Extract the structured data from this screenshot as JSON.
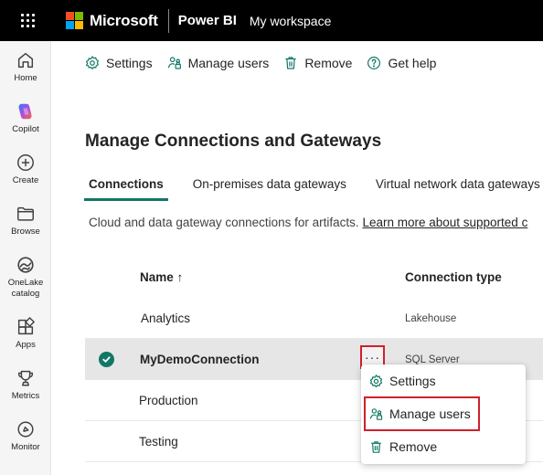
{
  "topbar": {
    "brand": "Microsoft",
    "app": "Power BI",
    "workspace": "My workspace",
    "logo_colors": [
      "#f25022",
      "#7fba00",
      "#00a4ef",
      "#ffb900"
    ]
  },
  "rail": {
    "items": [
      {
        "label": "Home",
        "icon": "home-icon"
      },
      {
        "label": "Copilot",
        "icon": "copilot-icon"
      },
      {
        "label": "Create",
        "icon": "create-icon"
      },
      {
        "label": "Browse",
        "icon": "folder-icon"
      },
      {
        "label": "OneLake catalog",
        "icon": "onelake-icon"
      },
      {
        "label": "Apps",
        "icon": "apps-icon"
      },
      {
        "label": "Metrics",
        "icon": "trophy-icon"
      },
      {
        "label": "Monitor",
        "icon": "monitor-icon"
      }
    ]
  },
  "commands": {
    "settings": "Settings",
    "manage_users": "Manage users",
    "remove": "Remove",
    "get_help": "Get help"
  },
  "page": {
    "title": "Manage Connections and Gateways",
    "tabs": [
      "Connections",
      "On-premises data gateways",
      "Virtual network data gateways"
    ],
    "active_tab": "Connections",
    "description": "Cloud and data gateway connections for artifacts.",
    "learn_more": "Learn more about supported c"
  },
  "table": {
    "headers": {
      "name": "Name ↑",
      "type": "Connection type"
    },
    "rows": [
      {
        "name": "Analytics",
        "type": "Lakehouse"
      },
      {
        "name": "MyDemoConnection",
        "type": "SQL Server",
        "selected": true
      },
      {
        "name": "Production",
        "type": ""
      },
      {
        "name": "Testing",
        "type": ""
      }
    ],
    "more_label": "···"
  },
  "menu": {
    "items": [
      "Settings",
      "Manage users",
      "Remove"
    ]
  },
  "colors": {
    "accent": "#117865",
    "highlight_box": "#d0202c"
  }
}
